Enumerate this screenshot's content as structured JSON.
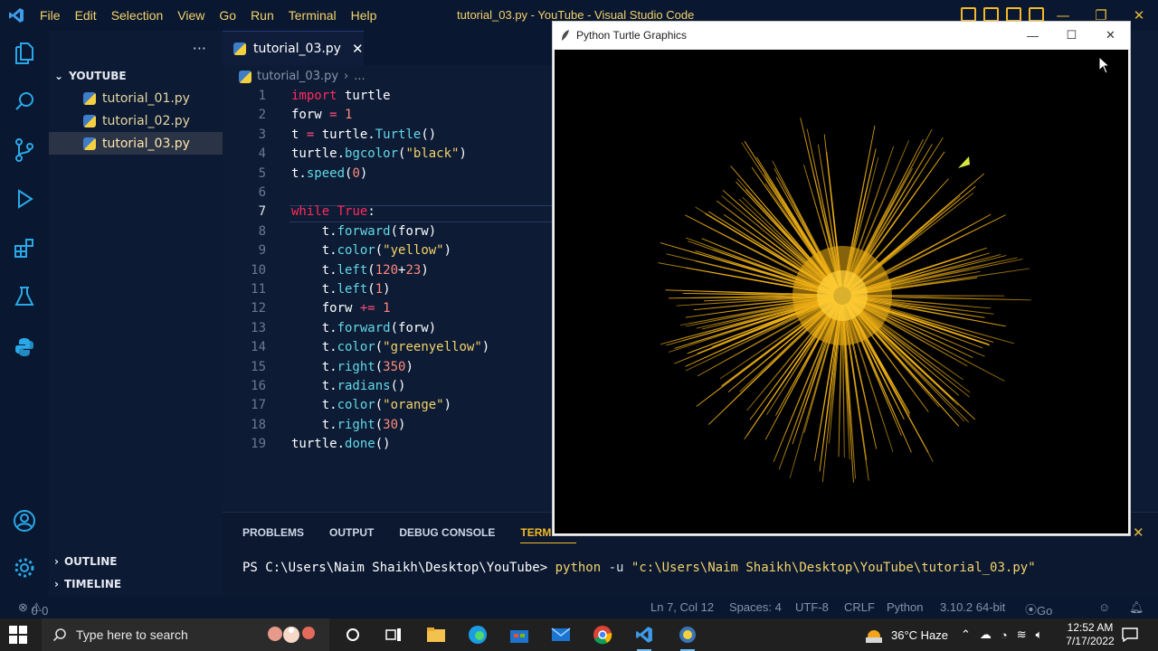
{
  "window": {
    "title": "tutorial_03.py - YouTube - Visual Studio Code",
    "menu": [
      "File",
      "Edit",
      "Selection",
      "View",
      "Go",
      "Run",
      "Terminal",
      "Help"
    ]
  },
  "explorer": {
    "folder": "YOUTUBE",
    "files": [
      "tutorial_01.py",
      "tutorial_02.py",
      "tutorial_03.py"
    ],
    "active_file": "tutorial_03.py",
    "sections": [
      "OUTLINE",
      "TIMELINE"
    ]
  },
  "editor": {
    "tab_label": "tutorial_03.py",
    "breadcrumb_file": "tutorial_03.py",
    "breadcrumb_more": "...",
    "current_line": 7,
    "lines": [
      "import turtle",
      "forw = 1",
      "t = turtle.Turtle()",
      "turtle.bgcolor(\"black\")",
      "t.speed(0)",
      "",
      "while True:",
      "    t.forward(forw)",
      "    t.color(\"yellow\")",
      "    t.left(120+23)",
      "    t.left(1)",
      "    forw += 1",
      "    t.forward(forw)",
      "    t.color(\"greenyellow\")",
      "    t.right(350)",
      "    t.radians()",
      "    t.color(\"orange\")",
      "    t.right(30)",
      "turtle.done()"
    ]
  },
  "panel": {
    "tabs": [
      "PROBLEMS",
      "OUTPUT",
      "DEBUG CONSOLE",
      "TERMINAL"
    ],
    "active_tab": "TERMINAL",
    "prompt": "PS C:\\Users\\Naim Shaikh\\Desktop\\YouTube>",
    "command": "python",
    "flag": "-u",
    "path_arg": "\"c:\\Users\\Naim Shaikh\\Desktop\\YouTube\\tutorial_03.py\""
  },
  "status": {
    "errors": "0",
    "warnings": "0",
    "position": "Ln 7, Col 12",
    "spaces": "Spaces: 4",
    "encoding": "UTF-8",
    "eol": "CRLF",
    "language": "Python",
    "interpreter": "3.10.2 64-bit",
    "go_live": "Go Live"
  },
  "turtle_window": {
    "title": "Python Turtle Graphics",
    "background": "#000000",
    "stroke_color": "#f2b316",
    "arrow_color": "#d8e640"
  },
  "taskbar": {
    "search_placeholder": "Type here to search",
    "weather": "36°C  Haze",
    "time": "12:52 AM",
    "date": "7/17/2022"
  },
  "colors": {
    "editor_bg": "#0d1b35",
    "accent": "#f3b928",
    "keyword": "#ff2b5e",
    "function": "#62d9e6",
    "string": "#f3d36a"
  }
}
